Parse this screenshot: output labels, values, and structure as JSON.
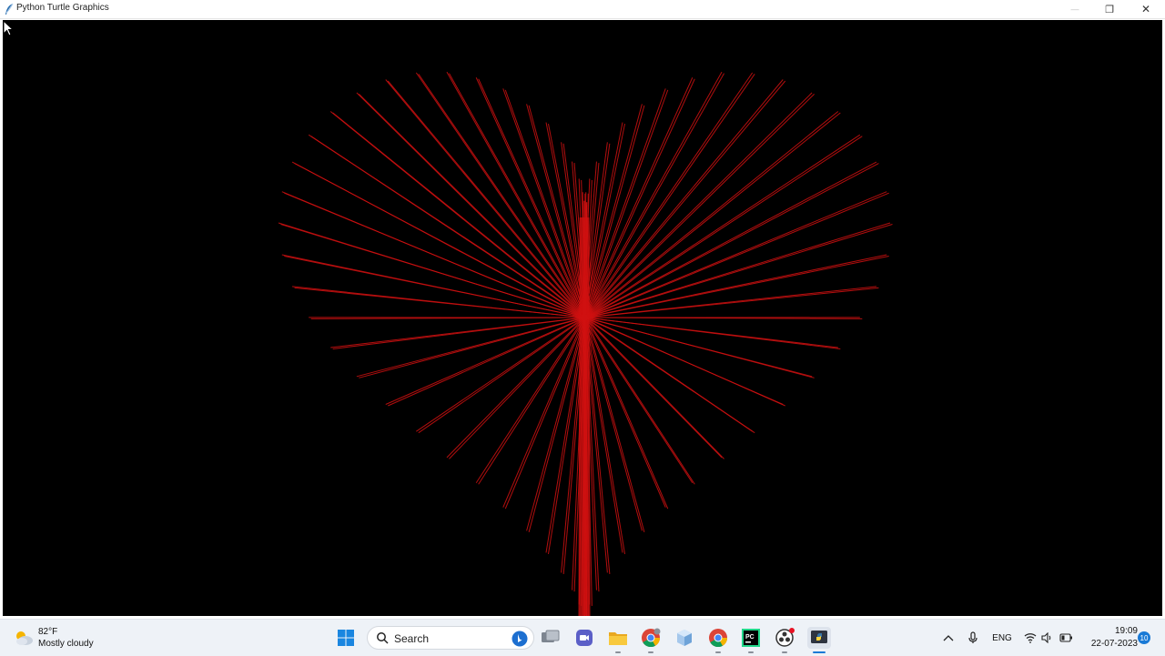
{
  "window": {
    "title": "Python Turtle Graphics",
    "minimize_glyph": "—",
    "maximize_glyph": "❐",
    "close_glyph": "✕",
    "canvas_background": "#000000",
    "stroke_color": "#d01010"
  },
  "taskbar": {
    "weather": {
      "temperature": "82°F",
      "condition": "Mostly cloudy",
      "icon": "cloud-sun-icon"
    },
    "search": {
      "label": "Search",
      "icon": "search-icon"
    },
    "pinned_apps": [
      {
        "name": "task-view",
        "icon": "task-view-icon"
      },
      {
        "name": "teams-meet",
        "icon": "video-chat-icon"
      },
      {
        "name": "file-explorer",
        "icon": "folder-icon"
      },
      {
        "name": "chrome-profile",
        "icon": "chrome-icon"
      },
      {
        "name": "3d-viewer",
        "icon": "cube-icon"
      },
      {
        "name": "chrome",
        "icon": "chrome-icon"
      },
      {
        "name": "pycharm",
        "icon": "pycharm-icon"
      },
      {
        "name": "obs",
        "icon": "record-icon"
      },
      {
        "name": "python-turtle",
        "icon": "python-icon"
      }
    ],
    "tray": {
      "language": "ENG",
      "clock_time": "19:09",
      "clock_date": "22-07-2023",
      "notification_count": "10"
    }
  }
}
